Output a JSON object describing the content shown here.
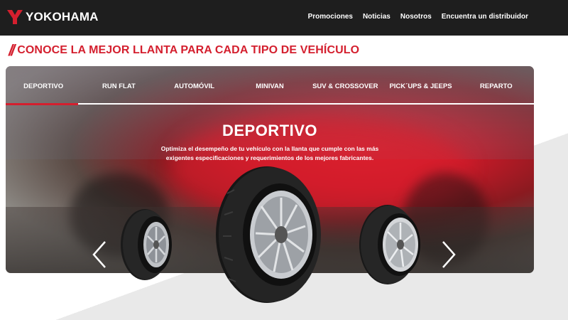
{
  "header": {
    "logo_text": "YOKOHAMA",
    "nav": [
      "Promociones",
      "Noticias",
      "Nosotros",
      "Encuentra un distribuidor"
    ]
  },
  "section": {
    "title": "CONOCE LA MEJOR LLANTA PARA CADA TIPO DE VEHÍCULO"
  },
  "banner": {
    "tabs": [
      "DEPORTIVO",
      "RUN FLAT",
      "AUTOMÓVIL",
      "MINIVAN",
      "SUV & CROSSOVER",
      "PICK´UPS & JEEPS",
      "REPARTO"
    ],
    "active_tab": "DEPORTIVO",
    "heading": "DEPORTIVO",
    "description": "Optimiza el desempeño de tu vehículo con la llanta que cumple con las más exigentes especificaciones y requerimientos de los mejores fabricantes."
  },
  "icons": {
    "logo": "yokohama-y-mark-icon",
    "prev": "chevron-left-icon",
    "next": "chevron-right-icon"
  },
  "colors": {
    "brand_red": "#d41f2e",
    "header_bg": "#1e1e1e"
  }
}
